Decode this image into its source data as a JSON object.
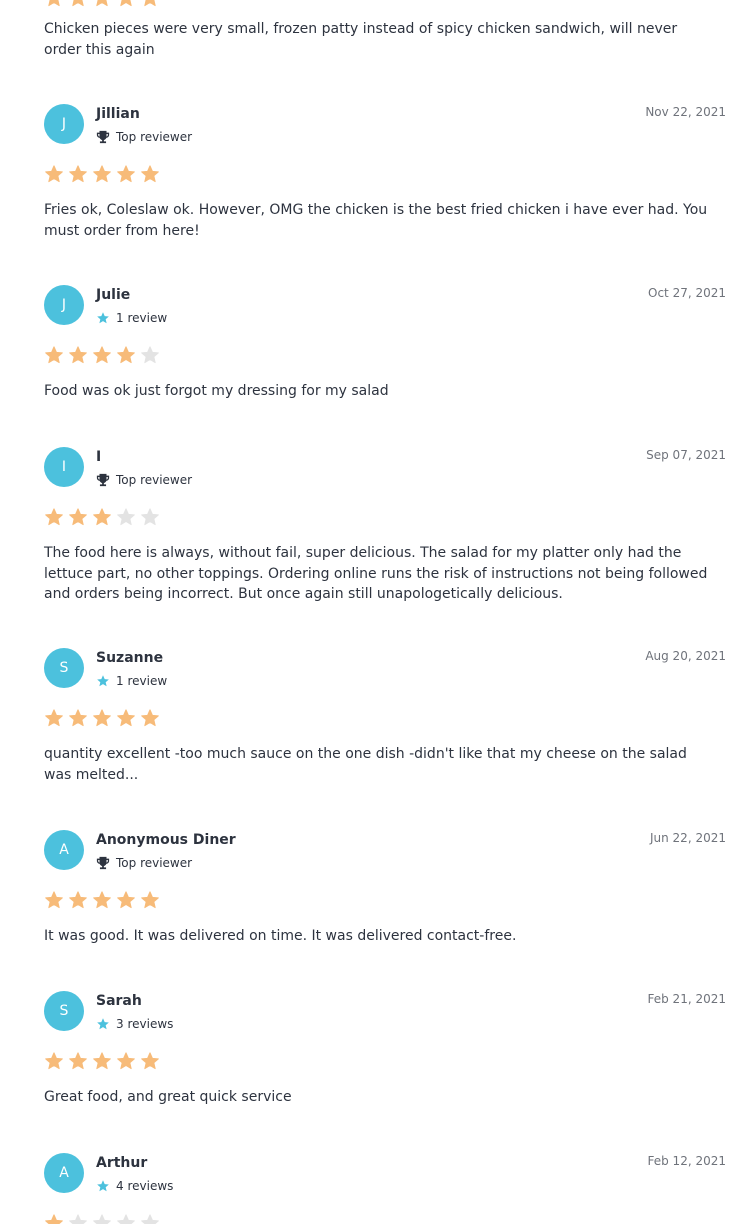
{
  "colors": {
    "avatar": "#4cc1dd",
    "star_filled": "#f7bb79",
    "star_empty": "#e3e3e3",
    "text": "#2d333f",
    "date": "#6f737b",
    "badge_star": "#4cc1dd"
  },
  "previous_review": {
    "rating": 5,
    "text": "Chicken pieces were very small, frozen patty instead of spicy chicken sandwich, will never order this again"
  },
  "reviews": [
    {
      "initial": "J",
      "name": "Jillian",
      "badge_icon": "trophy-icon",
      "badge_text": "Top reviewer",
      "date": "Nov 22, 2021",
      "rating": 5,
      "text": "Fries ok, Coleslaw ok. However, OMG the chicken is the best fried chicken i have ever had. You must order from here!"
    },
    {
      "initial": "J",
      "name": "Julie",
      "badge_icon": "star-icon",
      "badge_text": "1 review",
      "date": "Oct 27, 2021",
      "rating": 4,
      "text": "Food was ok just forgot my dressing for my salad"
    },
    {
      "initial": "I",
      "name": "I",
      "badge_icon": "trophy-icon",
      "badge_text": "Top reviewer",
      "date": "Sep 07, 2021",
      "rating": 3,
      "text": "The food here is always, without fail, super delicious. The salad for my platter only had the lettuce part, no other toppings. Ordering online runs the risk of instructions not being followed and orders being incorrect. But once again still unapologetically delicious."
    },
    {
      "initial": "S",
      "name": "Suzanne",
      "badge_icon": "star-icon",
      "badge_text": "1 review",
      "date": "Aug 20, 2021",
      "rating": 5,
      "text": "quantity excellent -too much sauce on the one dish -didn't like that my cheese on the salad was melted..."
    },
    {
      "initial": "A",
      "name": "Anonymous Diner",
      "badge_icon": "trophy-icon",
      "badge_text": "Top reviewer",
      "date": "Jun 22, 2021",
      "rating": 5,
      "text": "It was good. It was delivered on time. It was delivered contact-free."
    },
    {
      "initial": "S",
      "name": "Sarah",
      "badge_icon": "star-icon",
      "badge_text": "3 reviews",
      "date": "Feb 21, 2021",
      "rating": 5,
      "text": "Great food, and great quick service"
    },
    {
      "initial": "A",
      "name": "Arthur",
      "badge_icon": "star-icon",
      "badge_text": "4 reviews",
      "date": "Feb 12, 2021",
      "rating": 1,
      "text": ""
    }
  ]
}
